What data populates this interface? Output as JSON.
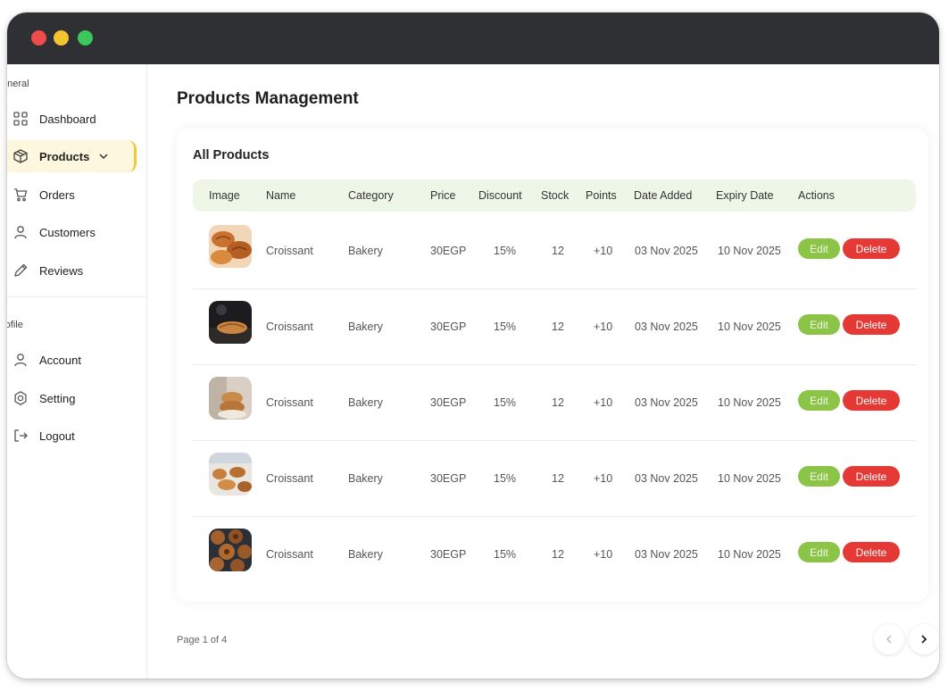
{
  "window": {
    "controls": [
      "close",
      "minimize",
      "maximize"
    ]
  },
  "sidebar": {
    "general_label": "eneral",
    "profile_label": "rofile",
    "items": [
      {
        "label": "Dashboard",
        "icon": "dashboard-icon"
      },
      {
        "label": "Products",
        "icon": "box-icon",
        "active": true
      },
      {
        "label": "Orders",
        "icon": "cart-icon"
      },
      {
        "label": "Customers",
        "icon": "user-icon"
      },
      {
        "label": "Reviews",
        "icon": "pencil-icon"
      }
    ],
    "profile_items": [
      {
        "label": "Account",
        "icon": "user-icon"
      },
      {
        "label": "Setting",
        "icon": "gear-icon"
      },
      {
        "label": "Logout",
        "icon": "logout-icon"
      }
    ]
  },
  "main": {
    "title": "Products Management",
    "card_title": "All Products",
    "columns": [
      "Image",
      "Name",
      "Category",
      "Price",
      "Discount",
      "Stock",
      "Points",
      "Date Added",
      "Expiry Date",
      "Actions"
    ],
    "rows": [
      {
        "name": "Croissant",
        "category": "Bakery",
        "price": "30EGP",
        "discount": "15%",
        "stock": "12",
        "points": "+10",
        "date_added": "03 Nov 2025",
        "expiry": "10 Nov 2025"
      },
      {
        "name": "Croissant",
        "category": "Bakery",
        "price": "30EGP",
        "discount": "15%",
        "stock": "12",
        "points": "+10",
        "date_added": "03 Nov 2025",
        "expiry": "10 Nov 2025"
      },
      {
        "name": "Croissant",
        "category": "Bakery",
        "price": "30EGP",
        "discount": "15%",
        "stock": "12",
        "points": "+10",
        "date_added": "03 Nov 2025",
        "expiry": "10 Nov 2025"
      },
      {
        "name": "Croissant",
        "category": "Bakery",
        "price": "30EGP",
        "discount": "15%",
        "stock": "12",
        "points": "+10",
        "date_added": "03 Nov 2025",
        "expiry": "10 Nov 2025"
      },
      {
        "name": "Croissant",
        "category": "Bakery",
        "price": "30EGP",
        "discount": "15%",
        "stock": "12",
        "points": "+10",
        "date_added": "03 Nov 2025",
        "expiry": "10 Nov 2025"
      }
    ],
    "edit_label": "Edit",
    "delete_label": "Delete",
    "pagination": "Page 1 of 4"
  },
  "colors": {
    "accent_yellow": "#f0cc3b",
    "edit_green": "#8cc448",
    "delete_red": "#e53935",
    "header_bg": "#eef6e8",
    "titlebar": "#2f3034"
  }
}
